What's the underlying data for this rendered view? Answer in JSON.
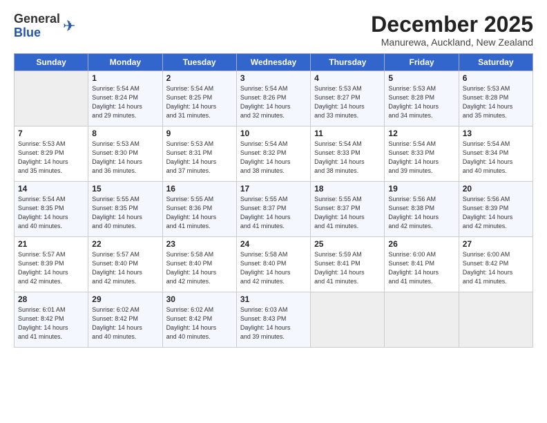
{
  "header": {
    "logo_general": "General",
    "logo_blue": "Blue",
    "title": "December 2025",
    "subtitle": "Manurewa, Auckland, New Zealand"
  },
  "days_of_week": [
    "Sunday",
    "Monday",
    "Tuesday",
    "Wednesday",
    "Thursday",
    "Friday",
    "Saturday"
  ],
  "weeks": [
    [
      {
        "day": "",
        "info": ""
      },
      {
        "day": "1",
        "info": "Sunrise: 5:54 AM\nSunset: 8:24 PM\nDaylight: 14 hours\nand 29 minutes."
      },
      {
        "day": "2",
        "info": "Sunrise: 5:54 AM\nSunset: 8:25 PM\nDaylight: 14 hours\nand 31 minutes."
      },
      {
        "day": "3",
        "info": "Sunrise: 5:54 AM\nSunset: 8:26 PM\nDaylight: 14 hours\nand 32 minutes."
      },
      {
        "day": "4",
        "info": "Sunrise: 5:53 AM\nSunset: 8:27 PM\nDaylight: 14 hours\nand 33 minutes."
      },
      {
        "day": "5",
        "info": "Sunrise: 5:53 AM\nSunset: 8:28 PM\nDaylight: 14 hours\nand 34 minutes."
      },
      {
        "day": "6",
        "info": "Sunrise: 5:53 AM\nSunset: 8:28 PM\nDaylight: 14 hours\nand 35 minutes."
      }
    ],
    [
      {
        "day": "7",
        "info": "Sunrise: 5:53 AM\nSunset: 8:29 PM\nDaylight: 14 hours\nand 35 minutes."
      },
      {
        "day": "8",
        "info": "Sunrise: 5:53 AM\nSunset: 8:30 PM\nDaylight: 14 hours\nand 36 minutes."
      },
      {
        "day": "9",
        "info": "Sunrise: 5:53 AM\nSunset: 8:31 PM\nDaylight: 14 hours\nand 37 minutes."
      },
      {
        "day": "10",
        "info": "Sunrise: 5:54 AM\nSunset: 8:32 PM\nDaylight: 14 hours\nand 38 minutes."
      },
      {
        "day": "11",
        "info": "Sunrise: 5:54 AM\nSunset: 8:33 PM\nDaylight: 14 hours\nand 38 minutes."
      },
      {
        "day": "12",
        "info": "Sunrise: 5:54 AM\nSunset: 8:33 PM\nDaylight: 14 hours\nand 39 minutes."
      },
      {
        "day": "13",
        "info": "Sunrise: 5:54 AM\nSunset: 8:34 PM\nDaylight: 14 hours\nand 40 minutes."
      }
    ],
    [
      {
        "day": "14",
        "info": "Sunrise: 5:54 AM\nSunset: 8:35 PM\nDaylight: 14 hours\nand 40 minutes."
      },
      {
        "day": "15",
        "info": "Sunrise: 5:55 AM\nSunset: 8:35 PM\nDaylight: 14 hours\nand 40 minutes."
      },
      {
        "day": "16",
        "info": "Sunrise: 5:55 AM\nSunset: 8:36 PM\nDaylight: 14 hours\nand 41 minutes."
      },
      {
        "day": "17",
        "info": "Sunrise: 5:55 AM\nSunset: 8:37 PM\nDaylight: 14 hours\nand 41 minutes."
      },
      {
        "day": "18",
        "info": "Sunrise: 5:55 AM\nSunset: 8:37 PM\nDaylight: 14 hours\nand 41 minutes."
      },
      {
        "day": "19",
        "info": "Sunrise: 5:56 AM\nSunset: 8:38 PM\nDaylight: 14 hours\nand 42 minutes."
      },
      {
        "day": "20",
        "info": "Sunrise: 5:56 AM\nSunset: 8:39 PM\nDaylight: 14 hours\nand 42 minutes."
      }
    ],
    [
      {
        "day": "21",
        "info": "Sunrise: 5:57 AM\nSunset: 8:39 PM\nDaylight: 14 hours\nand 42 minutes."
      },
      {
        "day": "22",
        "info": "Sunrise: 5:57 AM\nSunset: 8:40 PM\nDaylight: 14 hours\nand 42 minutes."
      },
      {
        "day": "23",
        "info": "Sunrise: 5:58 AM\nSunset: 8:40 PM\nDaylight: 14 hours\nand 42 minutes."
      },
      {
        "day": "24",
        "info": "Sunrise: 5:58 AM\nSunset: 8:40 PM\nDaylight: 14 hours\nand 42 minutes."
      },
      {
        "day": "25",
        "info": "Sunrise: 5:59 AM\nSunset: 8:41 PM\nDaylight: 14 hours\nand 41 minutes."
      },
      {
        "day": "26",
        "info": "Sunrise: 6:00 AM\nSunset: 8:41 PM\nDaylight: 14 hours\nand 41 minutes."
      },
      {
        "day": "27",
        "info": "Sunrise: 6:00 AM\nSunset: 8:42 PM\nDaylight: 14 hours\nand 41 minutes."
      }
    ],
    [
      {
        "day": "28",
        "info": "Sunrise: 6:01 AM\nSunset: 8:42 PM\nDaylight: 14 hours\nand 41 minutes."
      },
      {
        "day": "29",
        "info": "Sunrise: 6:02 AM\nSunset: 8:42 PM\nDaylight: 14 hours\nand 40 minutes."
      },
      {
        "day": "30",
        "info": "Sunrise: 6:02 AM\nSunset: 8:42 PM\nDaylight: 14 hours\nand 40 minutes."
      },
      {
        "day": "31",
        "info": "Sunrise: 6:03 AM\nSunset: 8:43 PM\nDaylight: 14 hours\nand 39 minutes."
      },
      {
        "day": "",
        "info": ""
      },
      {
        "day": "",
        "info": ""
      },
      {
        "day": "",
        "info": ""
      }
    ]
  ]
}
